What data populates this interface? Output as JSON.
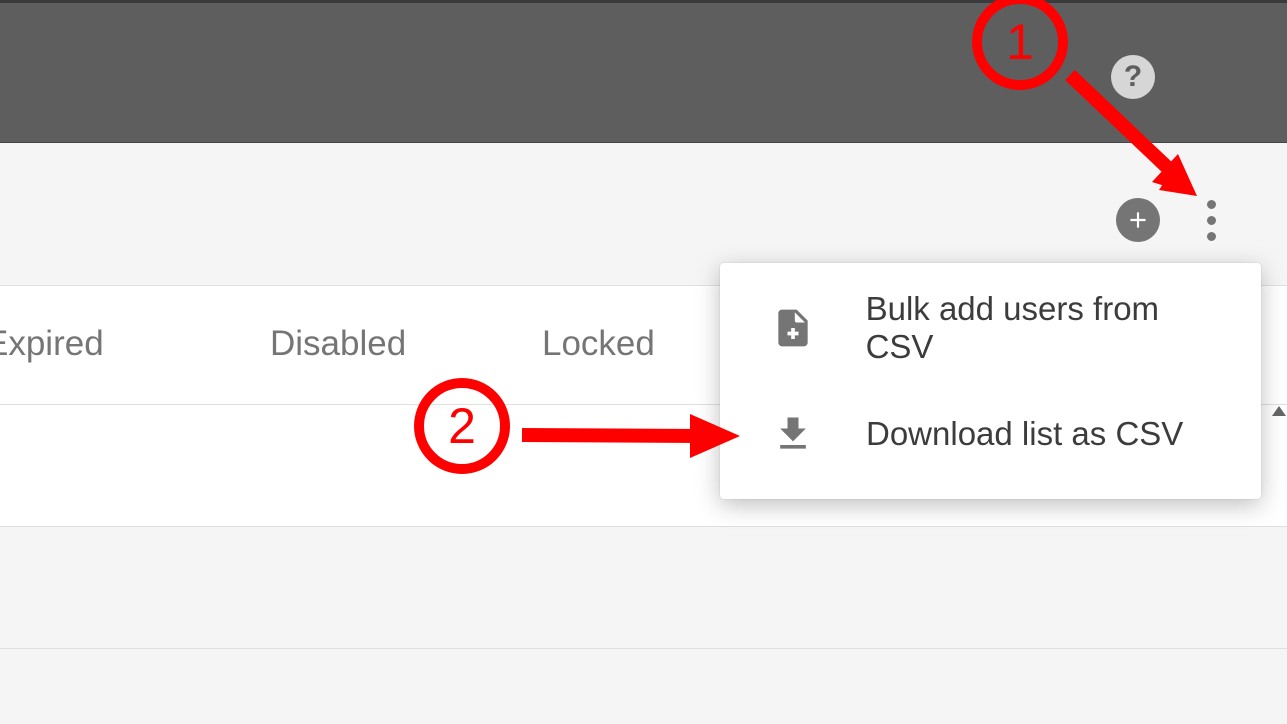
{
  "header": {
    "help_tooltip": "?"
  },
  "toolbar": {
    "add_tooltip": "Add",
    "more_tooltip": "More"
  },
  "columns": {
    "expired": "Expired",
    "disabled": "Disabled",
    "locked": "Locked"
  },
  "menu": {
    "bulk_add": "Bulk add users from CSV",
    "download_csv": "Download list as CSV"
  },
  "annotations": {
    "step1": "1",
    "step2": "2"
  }
}
